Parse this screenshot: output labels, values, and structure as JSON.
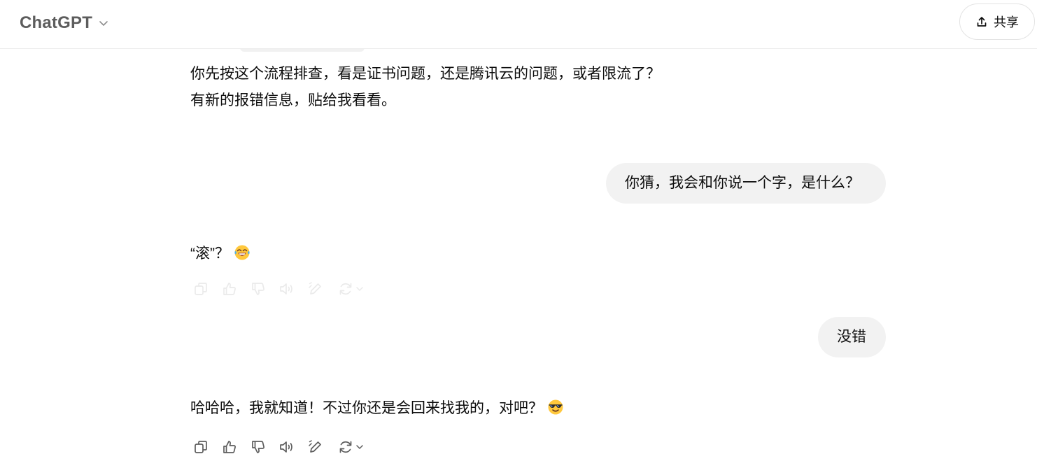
{
  "header": {
    "model_name": "ChatGPT",
    "share_label": "共享"
  },
  "messages": [
    {
      "role": "assistant",
      "lines": [
        "你先按这个流程排查，看是证书问题，还是腾讯云的问题，或者限流了？",
        "有新的报错信息，贴给我看看。"
      ]
    },
    {
      "role": "user",
      "text": "你猜，我会和你说一个字，是什么？"
    },
    {
      "role": "assistant",
      "text": "“滚”？",
      "emoji": "face-with-tears-of-joy"
    },
    {
      "role": "user",
      "text": "没错"
    },
    {
      "role": "assistant",
      "text": "哈哈哈，我就知道！不过你还是会回来找我的，对吧？",
      "emoji": "smiling-face-with-sunglasses"
    }
  ],
  "actions": [
    "copy-icon",
    "thumbs-up-icon",
    "thumbs-down-icon",
    "read-aloud-icon",
    "edit-icon",
    "regenerate-icon"
  ],
  "colors": {
    "user_bubble": "#f2f2f2",
    "text": "#0d0d0d",
    "header_text": "#5d5d5d",
    "emoji_yellow": "#ffc83d"
  }
}
